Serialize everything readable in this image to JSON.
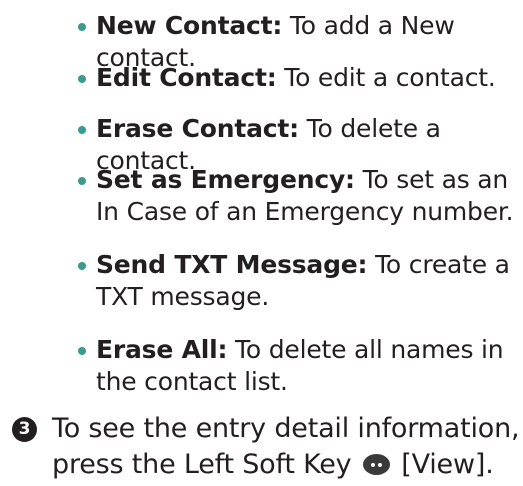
{
  "bullets": [
    {
      "term": "New Contact:",
      "desc": " To add a New contact."
    },
    {
      "term": "Edit Contact:",
      "desc": " To edit a contact."
    },
    {
      "term": "Erase Contact:",
      "desc": " To delete a contact."
    },
    {
      "term": "Set as Emergency:",
      "desc": " To set as an In Case of an Emergency number."
    },
    {
      "term": "Send TXT Message:",
      "desc": " To create a TXT message."
    },
    {
      "term": "Erase All:",
      "desc": " To delete all names in the contact list."
    }
  ],
  "step": {
    "number": "3",
    "text_before": "To see the entry detail information, press the Left Soft Key",
    "icon": "left-soft-key-icon",
    "text_after": "[View]."
  },
  "colors": {
    "bullet": "#3a9a8e",
    "text": "#231f20"
  }
}
